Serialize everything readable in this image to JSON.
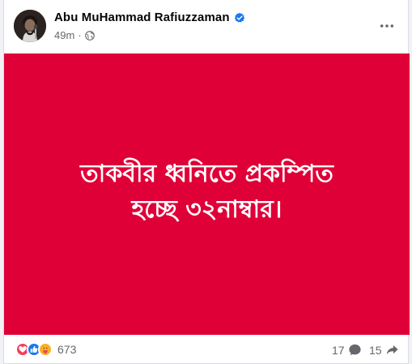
{
  "post": {
    "author": "Abu MuHammad Rafiuzzaman",
    "timestamp": "49m",
    "separator": "·",
    "privacy_icon": "globe-icon",
    "verified_icon": "verified-badge-icon",
    "menu_icon": "more-horizontal-icon",
    "image": {
      "background": "#e00038",
      "line1": "তাকবীর ধ্বনিতে প্রকম্পিত",
      "line2": "হচ্ছে ৩২নাম্বার।"
    }
  },
  "engagement": {
    "reaction_icons": [
      "love-icon",
      "like-icon",
      "care-icon"
    ],
    "reaction_count": "673",
    "comment_count": "17",
    "comment_icon": "comment-icon",
    "share_count": "15",
    "share_icon": "share-icon"
  },
  "colors": {
    "accent": "#1877f2",
    "love": "#f33e58",
    "care": "#f7b125",
    "secondary_text": "#65676b"
  }
}
